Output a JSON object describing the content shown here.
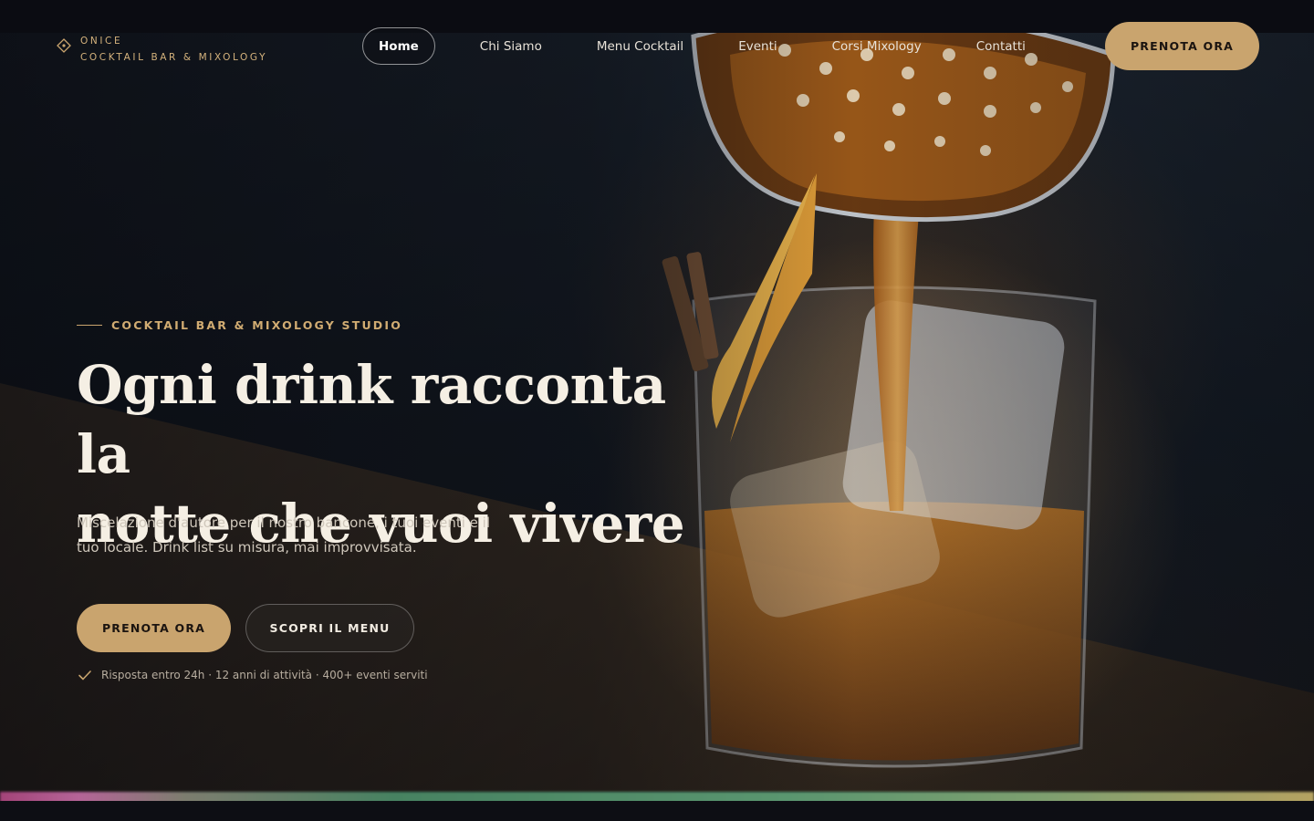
{
  "brand": {
    "name": "ONICE",
    "tagline": "COCKTAIL BAR & MIXOLOGY"
  },
  "nav": {
    "items": [
      {
        "label": "Home",
        "active": true
      },
      {
        "label": "Chi Siamo"
      },
      {
        "label": "Menu Cocktail"
      },
      {
        "label": "Eventi"
      },
      {
        "label": "Corsi Mixology"
      },
      {
        "label": "Contatti"
      }
    ],
    "cta_label": "PRENOTA ORA"
  },
  "hero": {
    "eyebrow": "COCKTAIL BAR & MIXOLOGY STUDIO",
    "headline_line1": "Ogni drink racconta la",
    "headline_line2": "notte che vuoi vivere",
    "subtext": "Miscelazione d'autore per il nostro bancone, i tuoi eventi e il tuo locale. Drink list su misura, mai improvvisata.",
    "primary_cta": "PRENOTA ORA",
    "secondary_cta": "SCOPRI IL MENU",
    "trust_line": "Risposta entro 24h · 12 anni di attività · 400+ eventi serviti",
    "trust_icon": "check-icon"
  },
  "colors": {
    "accent": "#c9a46e",
    "background": "#0b0c12",
    "headline": "#f5efe4"
  }
}
